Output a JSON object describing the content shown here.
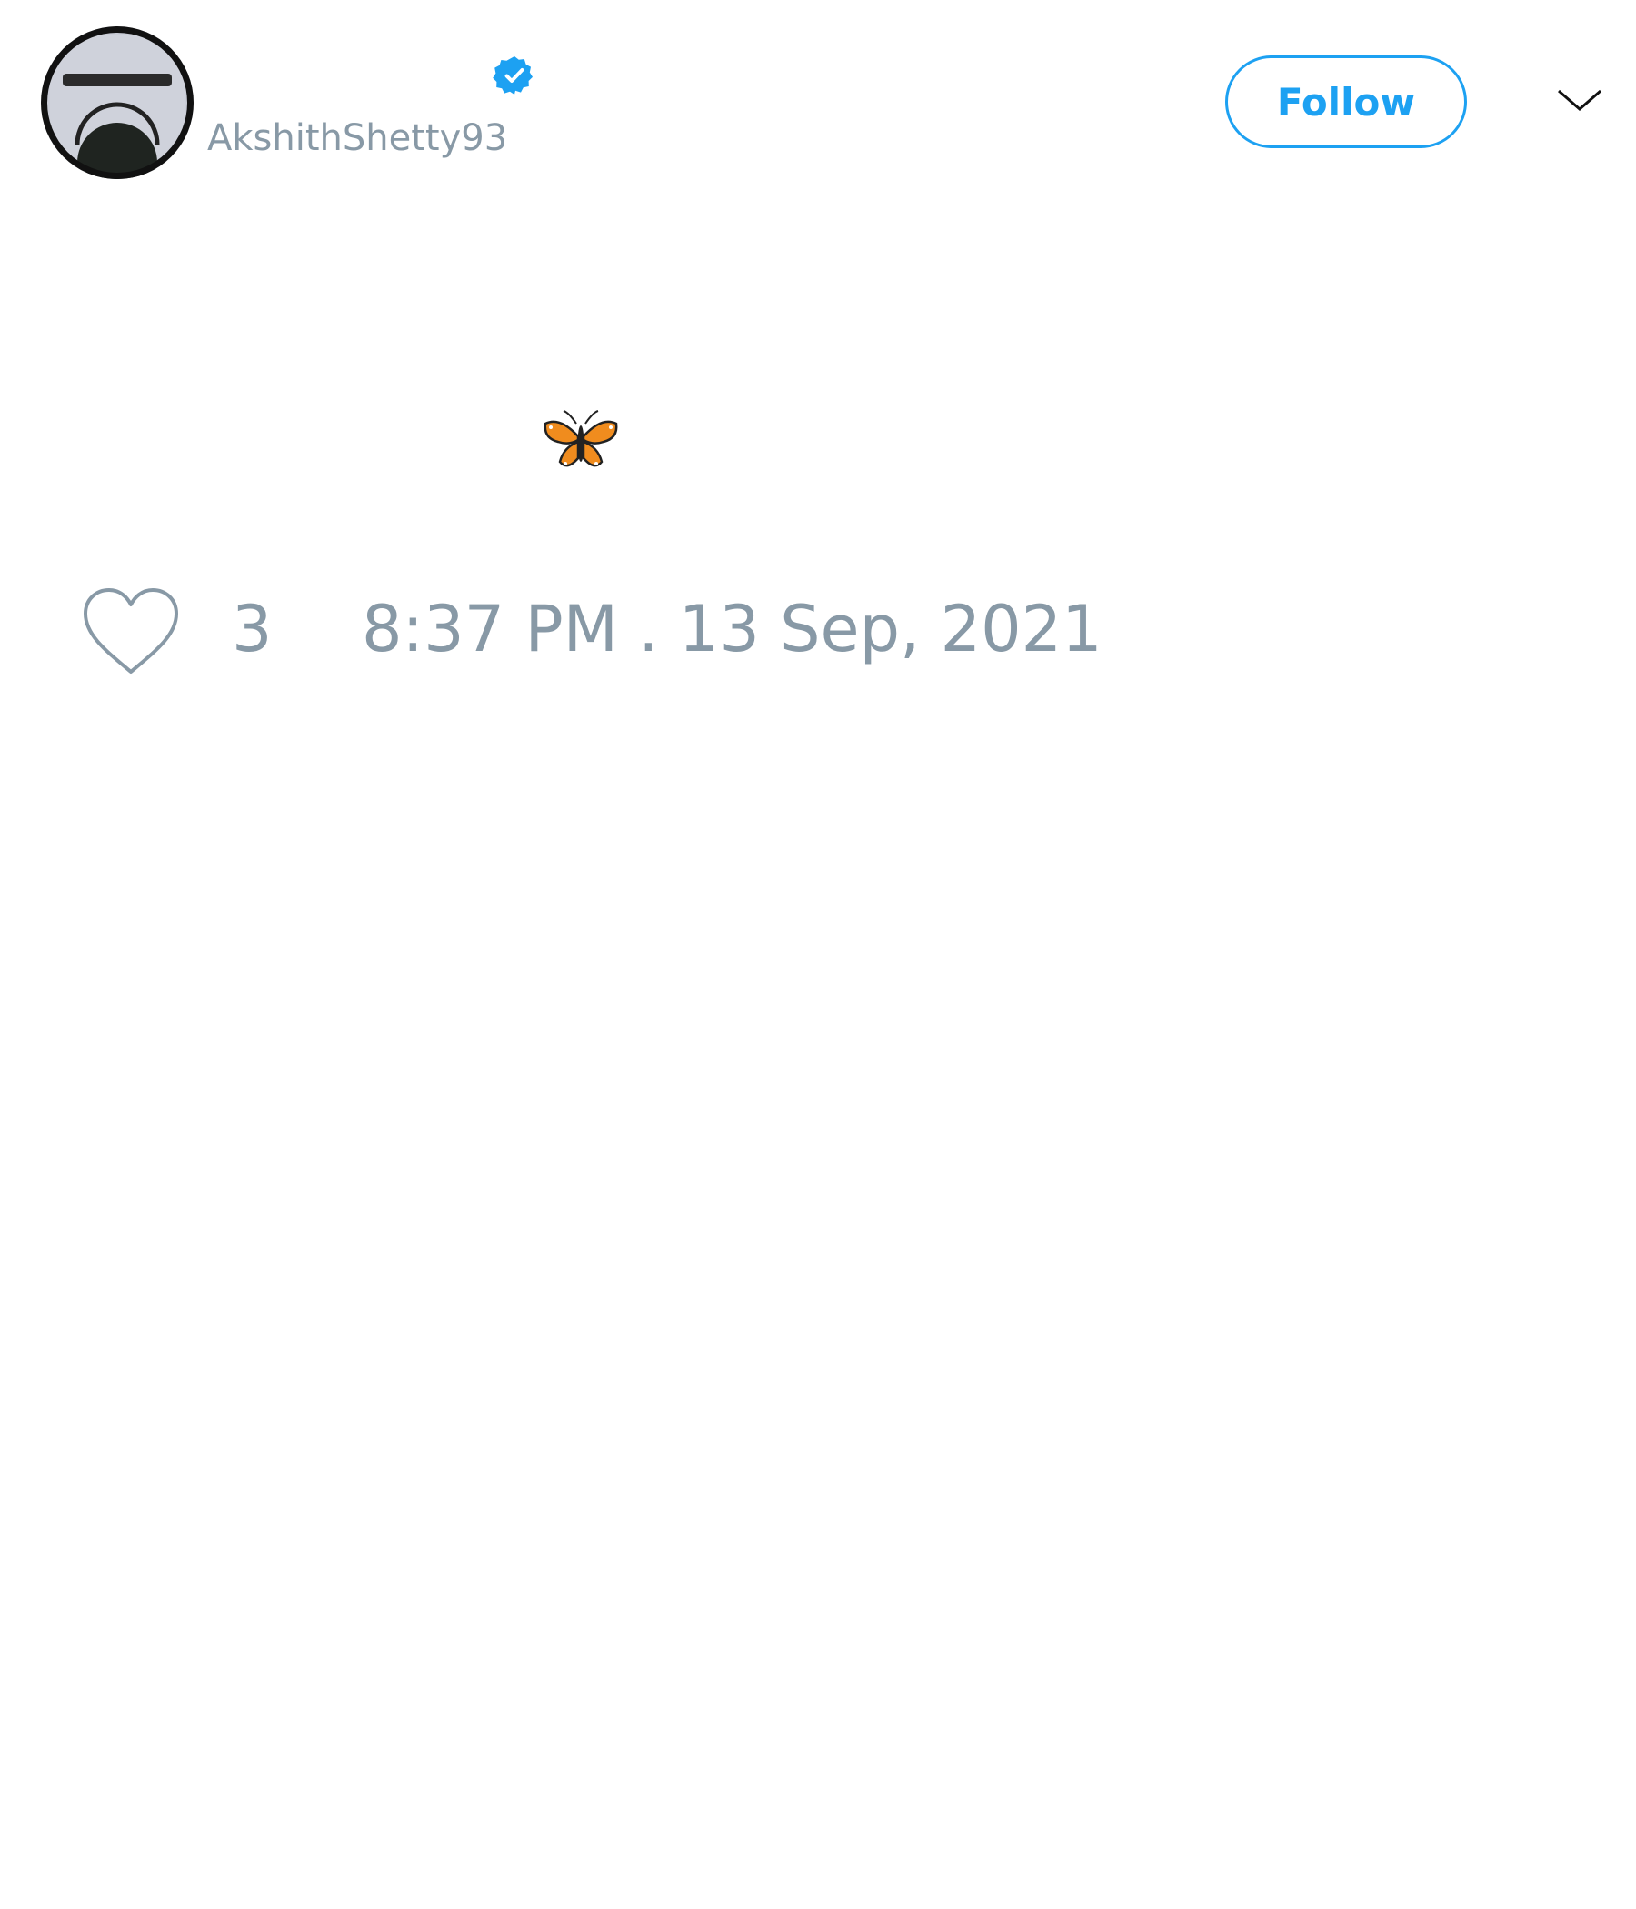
{
  "tweet": {
    "author": {
      "username": "AkshithShetty93",
      "avatar": "avatar-image",
      "verified": true,
      "verified_icon": "verified-badge-icon"
    },
    "follow_label": "Follow",
    "menu_icon": "chevron-down-icon",
    "content_emoji": "butterfly",
    "likes": {
      "icon": "heart-icon",
      "count": "3"
    },
    "timestamp": "8:37 PM . 13 Sep, 2021"
  },
  "colors": {
    "accent": "#1da1f2",
    "muted_text": "#8899a6",
    "background": "#ffffff"
  }
}
